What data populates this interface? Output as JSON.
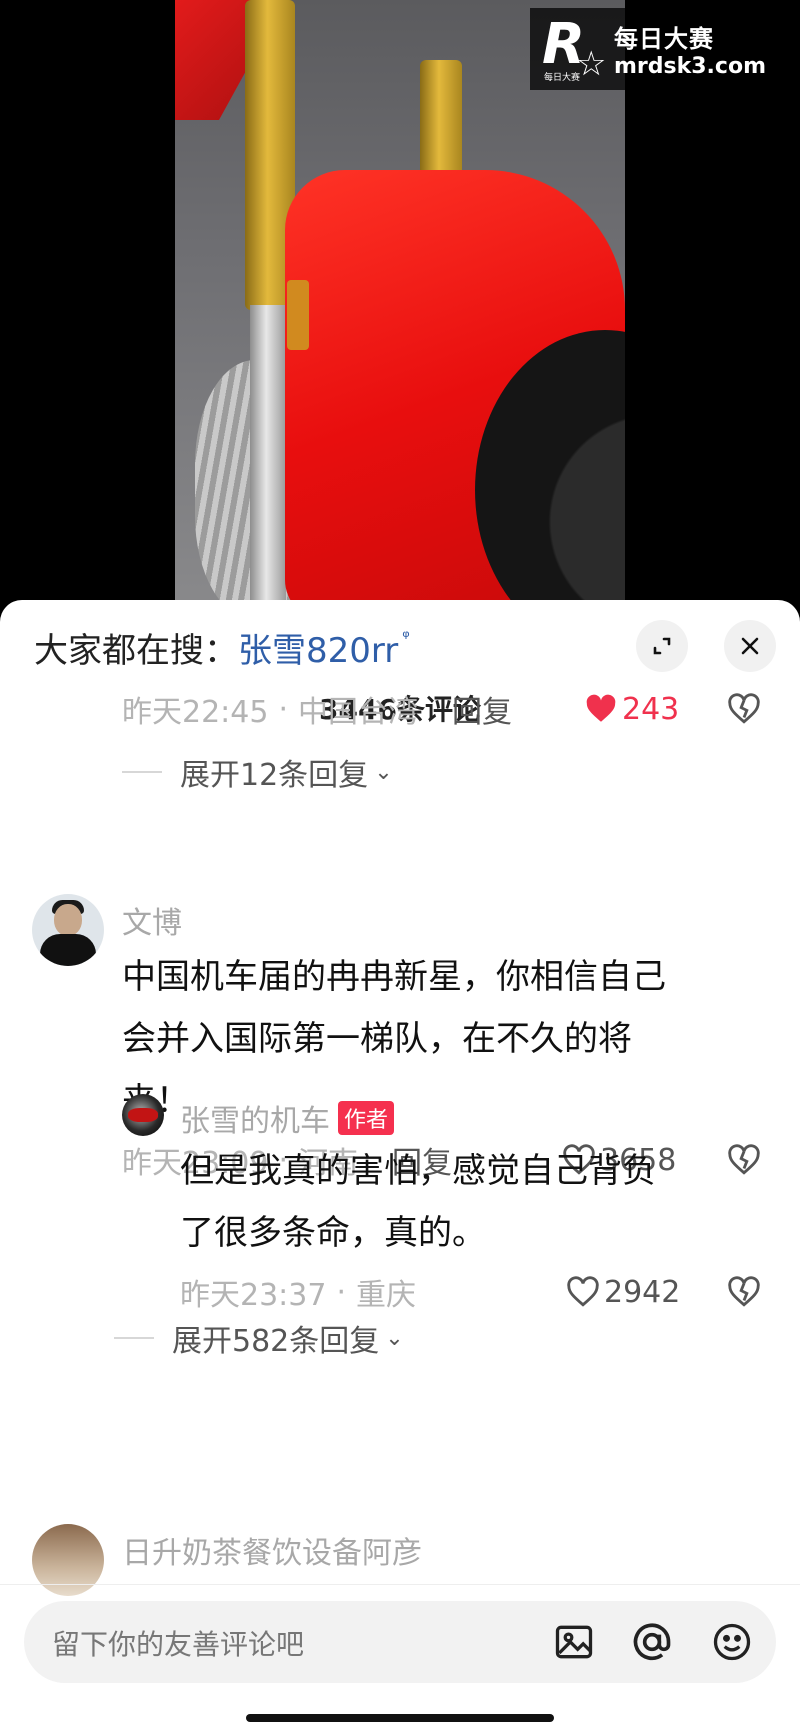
{
  "watermark": {
    "logo_text": "R",
    "logo_sub": "每日大赛",
    "title": "每日大赛",
    "url": "mrdsk3.com"
  },
  "panel": {
    "search_prefix": "大家都在搜：",
    "search_term": "张雪820rr",
    "comment_count": "3446条评论"
  },
  "thread1": {
    "time": "昨天22:45",
    "location": "中国台湾",
    "reply": "回复",
    "likes": "243",
    "expand": "展开12条回复"
  },
  "comment2": {
    "username": "文博",
    "text_line1": "中国机车届的冉冉新星，你相信自己",
    "text_line2": "会并入国际第一梯队，在不久的将",
    "text_line3": "来！",
    "time": "昨天23:09",
    "location": "河南",
    "reply": "回复",
    "likes": "3658"
  },
  "reply2": {
    "username": "张雪的机车",
    "tag": "作者",
    "text_line1": "但是我真的害怕，感觉自己背负",
    "text_line2": "了很多条命，真的。",
    "time": "昨天23:37",
    "location": "重庆",
    "likes": "2942"
  },
  "expand2": "展开582条回复",
  "comment3": {
    "username": "日升奶茶餐饮设备阿彦"
  },
  "input": {
    "placeholder": "留下你的友善评论吧"
  },
  "icons": [
    "expand-icon",
    "close-icon",
    "heart-icon",
    "dislike-icon",
    "image-icon",
    "at-icon",
    "emoji-icon"
  ],
  "colors": {
    "like_red": "#f0314d",
    "search_link": "#2f5ea8",
    "author_tag": "#f5304e"
  }
}
